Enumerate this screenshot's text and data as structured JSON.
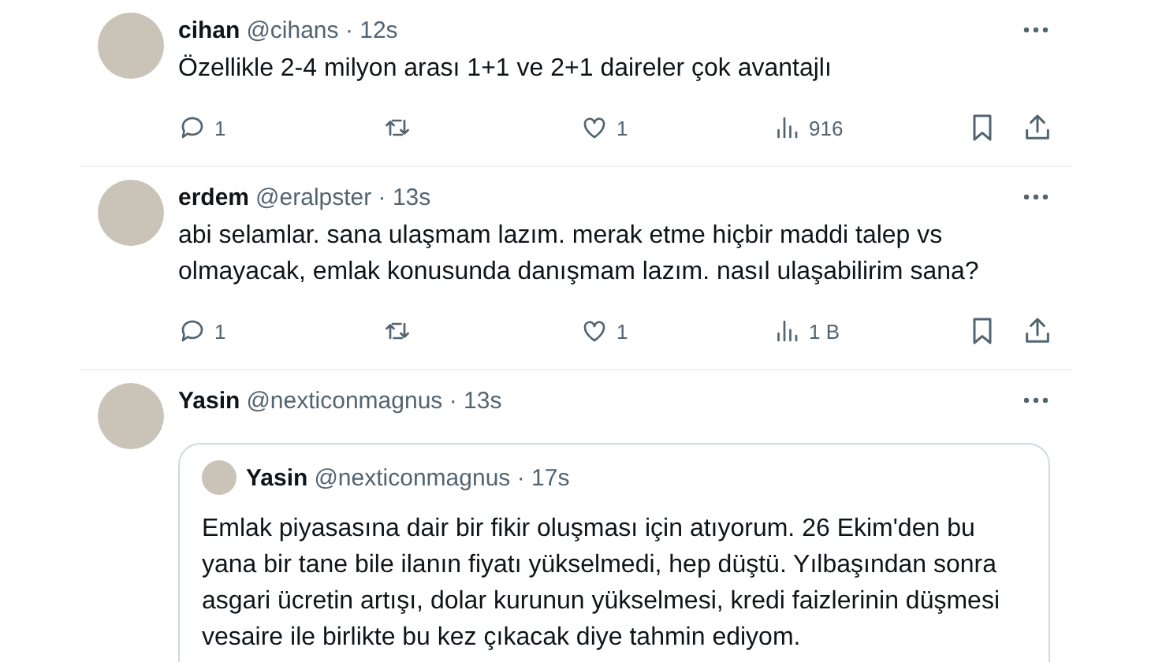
{
  "tweets": [
    {
      "name": "cihan",
      "handle": "@cihans",
      "sep": "·",
      "time": "12s",
      "text": [
        "Özellikle 2-4 milyon arası 1+1 ve 2+1 daireler çok avantajlı"
      ],
      "replies": "1",
      "likes": "1",
      "views": "916"
    },
    {
      "name": "erdem",
      "handle": "@eralpster",
      "sep": "·",
      "time": "13s",
      "text": [
        "abi selamlar. sana ulaşmam lazım. merak etme hiçbir maddi talep vs",
        "olmayacak, emlak konusunda danışmam lazım. nasıl ulaşabilirim sana?"
      ],
      "replies": "1",
      "likes": "1",
      "views": "1 B"
    },
    {
      "name": "Yasin",
      "handle": "@nexticonmagnus",
      "sep": "·",
      "time": "13s",
      "quote": {
        "name": "Yasin",
        "handle": "@nexticonmagnus",
        "sep": "·",
        "time": "17s",
        "text": [
          "Emlak piyasasına dair bir fikir oluşması için atıyorum. 26 Ekim'den bu",
          "yana bir tane bile ilanın fiyatı yükselmedi, hep düştü. Yılbaşından sonra",
          "asgari ücretin artışı, dolar kurunun yükselmesi, kredi faizlerinin düşmesi",
          "vesaire ile birlikte bu kez çıkacak diye tahmin ediyom."
        ]
      }
    }
  ]
}
